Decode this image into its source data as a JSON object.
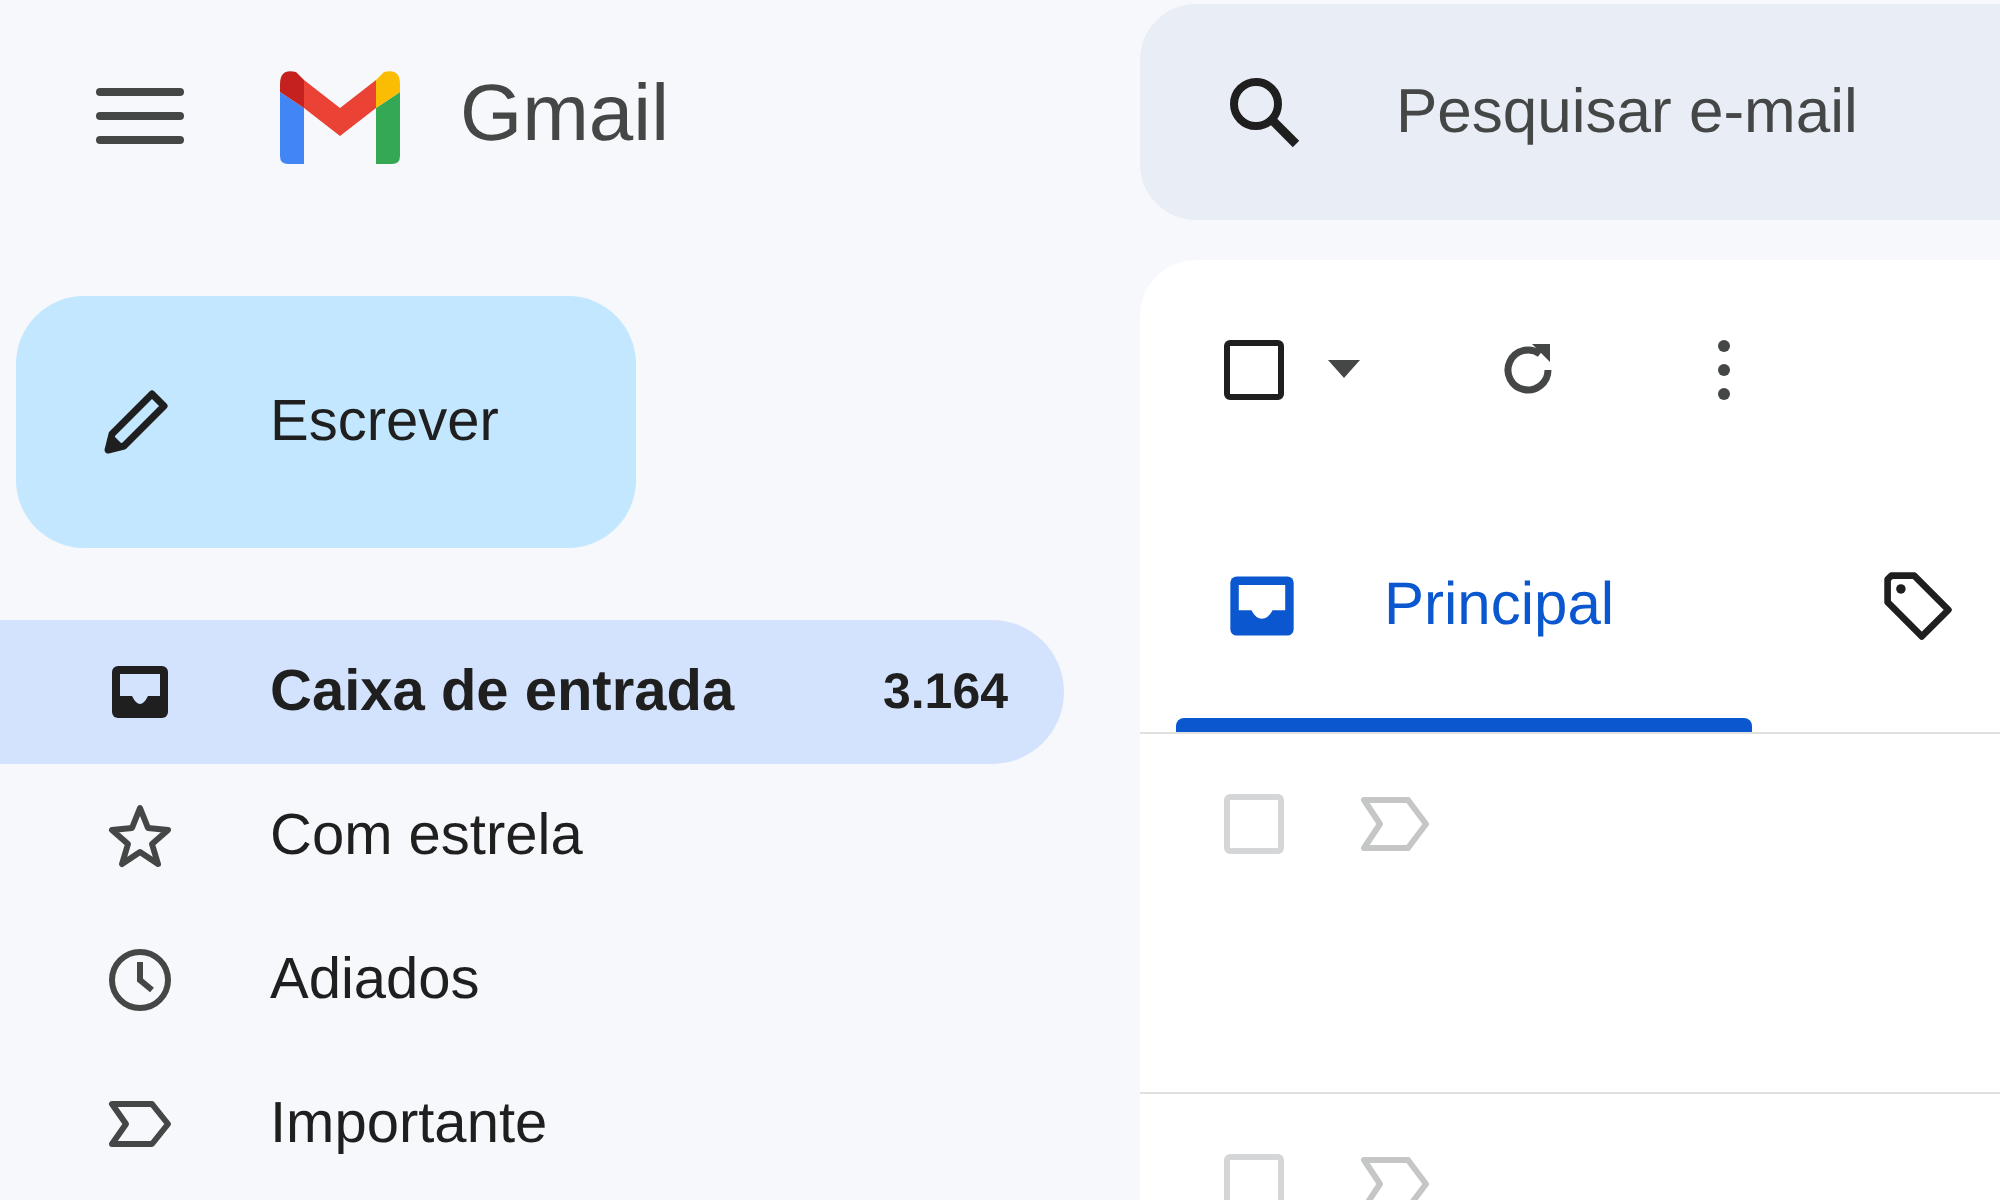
{
  "app": {
    "name": "Gmail"
  },
  "search": {
    "placeholder": "Pesquisar e-mail"
  },
  "compose": {
    "label": "Escrever"
  },
  "nav": [
    {
      "label": "Caixa de entrada",
      "count": "3.164",
      "selected": true
    },
    {
      "label": "Com estrela",
      "selected": false
    },
    {
      "label": "Adiados",
      "selected": false
    },
    {
      "label": "Importante",
      "selected": false
    }
  ],
  "toolbar": {
    "select_all_checked": false
  },
  "tabs": [
    {
      "label": "Principal",
      "selected": true
    },
    {
      "selected": false
    }
  ],
  "messages": [
    {
      "checked": false,
      "important": false
    },
    {
      "checked": false,
      "important": false
    }
  ]
}
